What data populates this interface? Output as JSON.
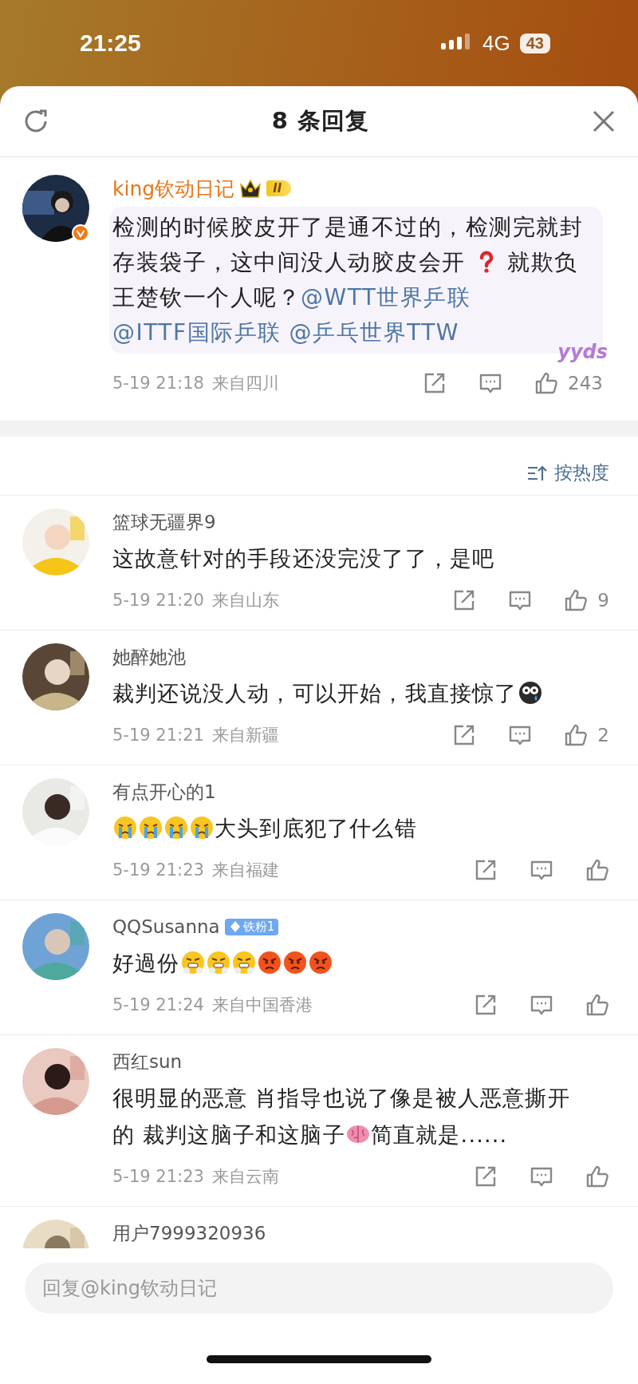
{
  "status_bar": {
    "time": "21:25",
    "network": "4G",
    "battery": "43"
  },
  "header": {
    "title": "8 条回复"
  },
  "main_comment": {
    "author": "king钦动日记",
    "level_badge": "II",
    "verified": true,
    "body": [
      {
        "kind": "text",
        "text": "检测的时候胶皮开了是通不过的，检测完就封存装袋子，这中间没人动胶皮会开 "
      },
      {
        "kind": "question"
      },
      {
        "kind": "text",
        "text": " 就欺负王楚钦一个人呢？"
      },
      {
        "kind": "mention",
        "text": "@WTT世界乒联"
      },
      {
        "kind": "mention",
        "text": "@ITTF国际乒联"
      },
      {
        "kind": "mention",
        "text": "@乒乓世界TTW"
      }
    ],
    "sticker": "yyds",
    "time": "5-19 21:18",
    "location": "来自四川",
    "likes": "243"
  },
  "sort": {
    "label": "按热度"
  },
  "comments": [
    {
      "author": "篮球无疆界9",
      "body": [
        {
          "kind": "text",
          "text": "这故意针对的手段还没完没了了，是吧"
        }
      ],
      "time": "5-19 21:20",
      "location": "来自山东",
      "likes": "9"
    },
    {
      "author": "她醉她池",
      "body": [
        {
          "kind": "text",
          "text": "裁判还说没人动，可以开始，我直接惊了"
        },
        {
          "kind": "shock"
        }
      ],
      "time": "5-19 21:21",
      "location": "来自新疆",
      "likes": "2"
    },
    {
      "author": "有点开心的1",
      "body": [
        {
          "kind": "cry"
        },
        {
          "kind": "cry"
        },
        {
          "kind": "cry"
        },
        {
          "kind": "cry"
        },
        {
          "kind": "text",
          "text": "大头到底犯了什么错"
        }
      ],
      "time": "5-19 21:23",
      "location": "来自福建"
    },
    {
      "author": "QQSusanna",
      "fan_badge": "铁粉1",
      "body": [
        {
          "kind": "text",
          "text": "好過份"
        },
        {
          "kind": "steam"
        },
        {
          "kind": "steam"
        },
        {
          "kind": "steam"
        },
        {
          "kind": "angry"
        },
        {
          "kind": "angry"
        },
        {
          "kind": "angry"
        }
      ],
      "time": "5-19 21:24",
      "location": "来自中国香港"
    },
    {
      "author": "西红sun",
      "body": [
        {
          "kind": "text",
          "text": "很明显的恶意 肖指导也说了像是被人恶意撕开的 裁判这脑子和这脑子"
        },
        {
          "kind": "brain"
        },
        {
          "kind": "text",
          "text": "简直就是......"
        }
      ],
      "time": "5-19 21:23",
      "location": "来自云南"
    },
    {
      "author": "用户7999320936"
    }
  ],
  "reply_box": {
    "placeholder": "回复@king钦动日记"
  }
}
